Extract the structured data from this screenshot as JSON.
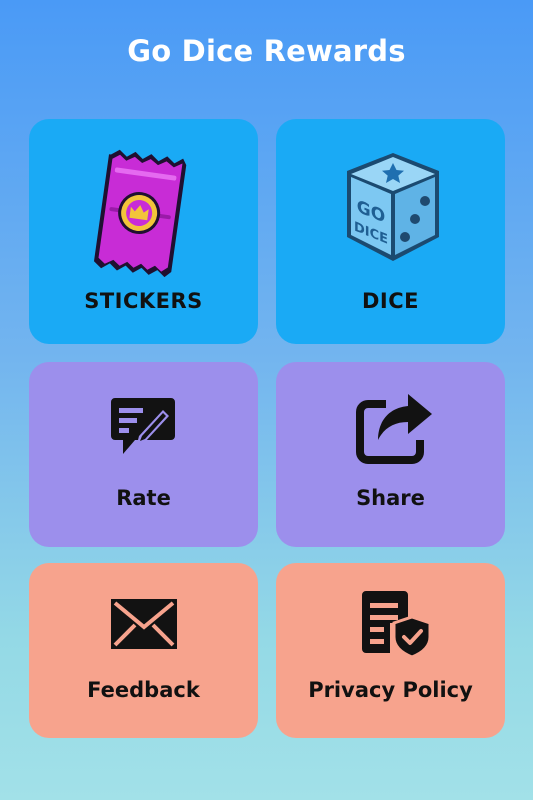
{
  "header": {
    "title": "Go Dice Rewards"
  },
  "tiles": {
    "stickers": {
      "label": "STICKERS",
      "icon": "sticker-pack-icon"
    },
    "dice": {
      "label": "DICE",
      "icon": "dice-icon",
      "dice_text": "GO DICE"
    },
    "rate": {
      "label": "Rate",
      "icon": "rate-message-icon"
    },
    "share": {
      "label": "Share",
      "icon": "share-icon"
    },
    "feedback": {
      "label": "Feedback",
      "icon": "envelope-icon"
    },
    "privacy": {
      "label": "Privacy Policy",
      "icon": "privacy-shield-icon"
    }
  },
  "colors": {
    "tile_blue": "#1aaaf5",
    "tile_purple": "#9c8fec",
    "tile_salmon": "#f7a38d",
    "sticker_pink": "#c82cd6",
    "sticker_gold": "#f2c43a",
    "dice_blue": "#7dc8f2"
  }
}
